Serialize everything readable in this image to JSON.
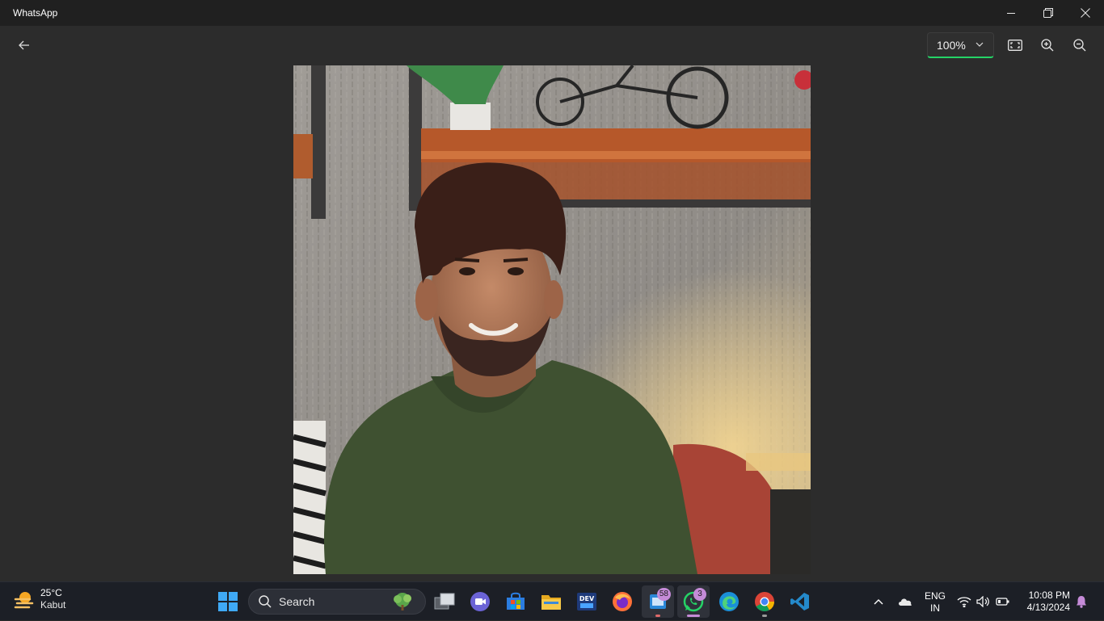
{
  "window": {
    "title": "WhatsApp"
  },
  "viewer": {
    "zoom_value": "100%"
  },
  "photo": {
    "description_icon": "portrait-photo"
  },
  "taskbar": {
    "weather": {
      "temp": "25°C",
      "condition": "Kabut"
    },
    "search_label": "Search",
    "apps": [
      {
        "name": "task-view",
        "badge": ""
      },
      {
        "name": "teams-meet",
        "badge": ""
      },
      {
        "name": "microsoft-store",
        "badge": ""
      },
      {
        "name": "file-explorer",
        "badge": ""
      },
      {
        "name": "dev-app",
        "badge": ""
      },
      {
        "name": "firefox",
        "badge": ""
      },
      {
        "name": "microsoft-todo",
        "badge": "58"
      },
      {
        "name": "whatsapp",
        "badge": "3"
      },
      {
        "name": "edge",
        "badge": ""
      },
      {
        "name": "chrome",
        "badge": ""
      },
      {
        "name": "vscode",
        "badge": ""
      }
    ],
    "language": {
      "line1": "ENG",
      "line2": "IN"
    },
    "clock": {
      "time": "10:08 PM",
      "date": "4/13/2024"
    }
  },
  "colors": {
    "accent": "#25d366",
    "taskbar_bg": "#1c1f26",
    "titlebar_bg": "#202020",
    "viewer_bg": "#2c2c2c"
  }
}
